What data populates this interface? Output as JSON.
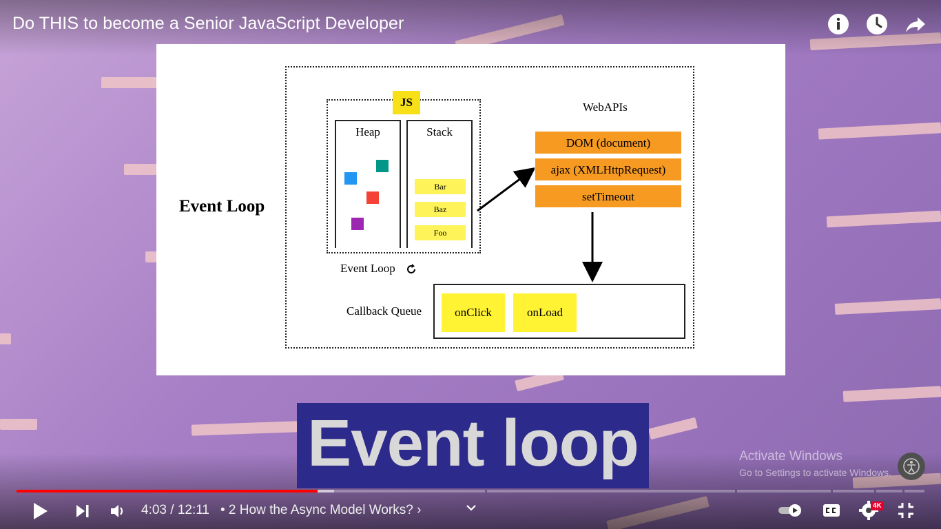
{
  "video": {
    "title": "Do THIS to become a Senior JavaScript Developer",
    "caption": "Event loop",
    "played_fraction": 0.3317,
    "buffered_fraction": 0.35
  },
  "top_controls": {
    "icons": [
      "info-icon",
      "watch-later-icon",
      "share-icon"
    ]
  },
  "slide": {
    "heading": "Event Loop",
    "js_badge": "JS",
    "heap_label": "Heap",
    "stack_label": "Stack",
    "stack_frames": [
      "Bar",
      "Baz",
      "Foo"
    ],
    "heap_object_colors": [
      "#2196f3",
      "#009688",
      "#f44336",
      "#9c27b0"
    ],
    "event_loop_label": "Event Loop",
    "webapis_label": "WebAPIs",
    "webapis": [
      "DOM (document)",
      "ajax (XMLHttpRequest)",
      "setTimeout"
    ],
    "callback_queue_label": "Callback Queue",
    "callbacks": [
      "onClick",
      "onLoad"
    ],
    "colors": {
      "frame": "#fff35a",
      "api": "#f69a22",
      "callback": "#fff333",
      "js": "#f7e018"
    }
  },
  "player": {
    "current_time": "4:03",
    "duration": "12:11",
    "time_separator": " / ",
    "chapter": "• 2 How the Async Model Works? ›",
    "quality_badge": "4K",
    "icons": [
      "play-icon",
      "next-icon",
      "volume-icon",
      "chevron-down-icon",
      "autoplay-toggle",
      "captions-icon",
      "settings-icon",
      "exit-fullscreen-icon"
    ]
  },
  "watermark": {
    "line1": "Activate Windows",
    "line2": "Go to Settings to activate Windows."
  },
  "colors": {
    "progress_played": "#ff0000",
    "caption_bg": "#2c2a8a"
  }
}
